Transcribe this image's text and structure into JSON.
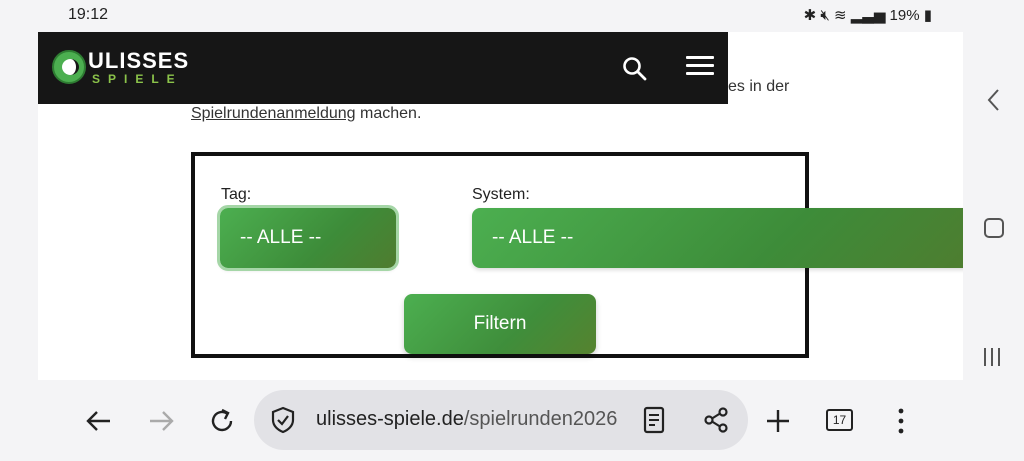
{
  "status_bar": {
    "time": "19:12",
    "battery": "19%"
  },
  "site": {
    "logo_word1": "ULISSES",
    "logo_word2": "SPIELE"
  },
  "intro": {
    "tail": "es in der",
    "link": "Spielrundenanmeldung",
    "after_link": " machen."
  },
  "filter": {
    "tag_label": "Tag:",
    "tag_value": "-- ALLE --",
    "system_label": "System:",
    "system_value": "-- ALLE --",
    "submit_label": "Filtern"
  },
  "browser": {
    "domain": "ulisses-spiele.de",
    "path": "/spielrunden2026",
    "tab_count": "17"
  },
  "colors": {
    "accent": "#4caf50",
    "header_bg": "#161616"
  },
  "icons": [
    "search-icon",
    "menu-icon",
    "back-icon",
    "forward-icon",
    "reload-icon",
    "shield-icon",
    "reader-icon",
    "share-icon",
    "plus-icon",
    "tabs-icon",
    "more-icon"
  ]
}
